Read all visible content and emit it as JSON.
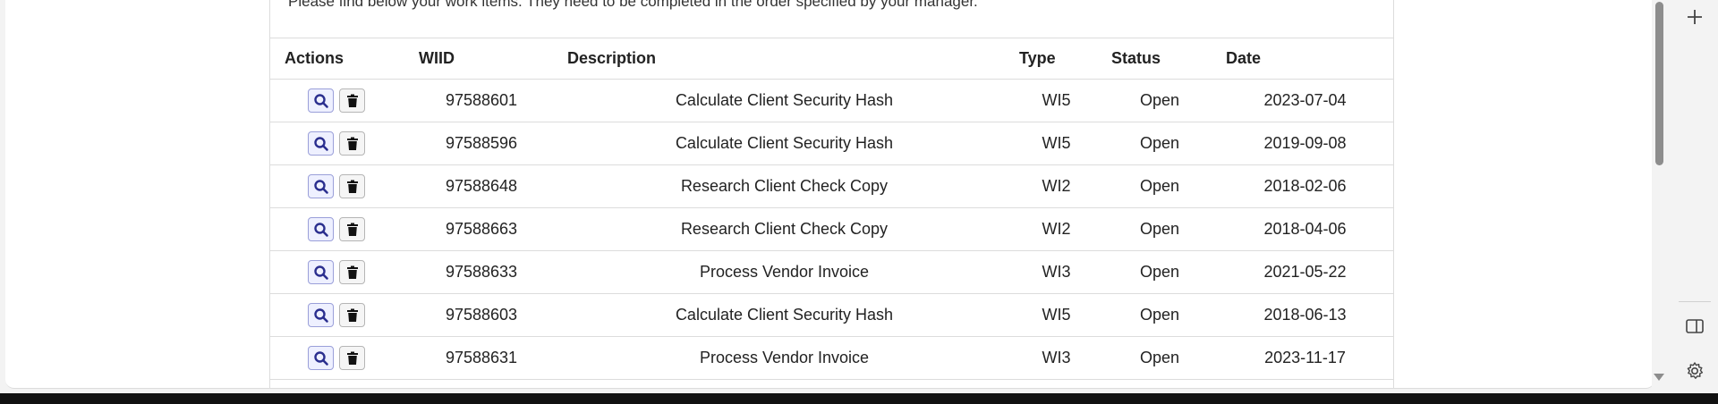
{
  "intro_text": "Please find below your work items. They need to be completed in the order specified by your manager.",
  "table": {
    "headers": {
      "actions": "Actions",
      "wiid": "WIID",
      "description": "Description",
      "type": "Type",
      "status": "Status",
      "date": "Date"
    },
    "rows": [
      {
        "wiid": "97588601",
        "description": "Calculate Client Security Hash",
        "type": "WI5",
        "status": "Open",
        "date": "2023-07-04"
      },
      {
        "wiid": "97588596",
        "description": "Calculate Client Security Hash",
        "type": "WI5",
        "status": "Open",
        "date": "2019-09-08"
      },
      {
        "wiid": "97588648",
        "description": "Research Client Check Copy",
        "type": "WI2",
        "status": "Open",
        "date": "2018-02-06"
      },
      {
        "wiid": "97588663",
        "description": "Research Client Check Copy",
        "type": "WI2",
        "status": "Open",
        "date": "2018-04-06"
      },
      {
        "wiid": "97588633",
        "description": "Process Vendor Invoice",
        "type": "WI3",
        "status": "Open",
        "date": "2021-05-22"
      },
      {
        "wiid": "97588603",
        "description": "Calculate Client Security Hash",
        "type": "WI5",
        "status": "Open",
        "date": "2018-06-13"
      },
      {
        "wiid": "97588631",
        "description": "Process Vendor Invoice",
        "type": "WI3",
        "status": "Open",
        "date": "2023-11-17"
      }
    ]
  },
  "icons": {
    "view": "magnifier-icon",
    "delete": "trash-icon",
    "rail": [
      "plus-icon",
      "sidebar-toggle-icon",
      "gear-icon"
    ]
  },
  "colors": {
    "view_button_bg": "#eef0ff",
    "view_icon": "#2b2f8f"
  }
}
